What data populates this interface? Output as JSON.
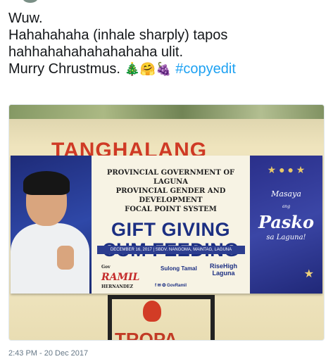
{
  "tweet": {
    "lines": [
      "Wuw.",
      "Hahahahaha (inhale sharply) tapos",
      "hahhahahahahahahaha ulit.",
      "Murry Chrustmus."
    ],
    "emojis": [
      "🎄",
      "🤗",
      "🍇"
    ],
    "hashtag": "#copyedit",
    "timestamp": "2:43 PM - 20 Dec 2017"
  },
  "media": {
    "wall_sign_top": "TANGHALANG",
    "wall_sign_bottom": "TROPA",
    "banner": {
      "org_lines": [
        "PROVINCIAL GOVERNMENT OF LAGUNA",
        "PROVINCIAL GENDER AND DEVELOPMENT",
        "FOCAL POINT SYSTEM"
      ],
      "event_lines": [
        "GIFT GIVING",
        "CUM FEEDING"
      ],
      "date_line": "DECEMBER 16, 2017 | SBDV. NANGOMA, MAINTAG, LAGUNA",
      "logo1_top": "Gov",
      "logo1_main": "RAMIL",
      "logo1_sub": "HERNANDEZ",
      "logo2": "Sulong Tamal",
      "logo3_top": "RiseHigh",
      "logo3_bottom": "Laguna",
      "social": "f ✉ ✪ GovRamil",
      "greeting_1": "Masaya",
      "greeting_2": "ang",
      "greeting_3": "Pasko",
      "greeting_4": "sa Laguna!"
    }
  },
  "colors": {
    "hashtag": "#1da1f2",
    "banner_blue": "#1c2f82",
    "sign_red": "#cf3a25"
  }
}
